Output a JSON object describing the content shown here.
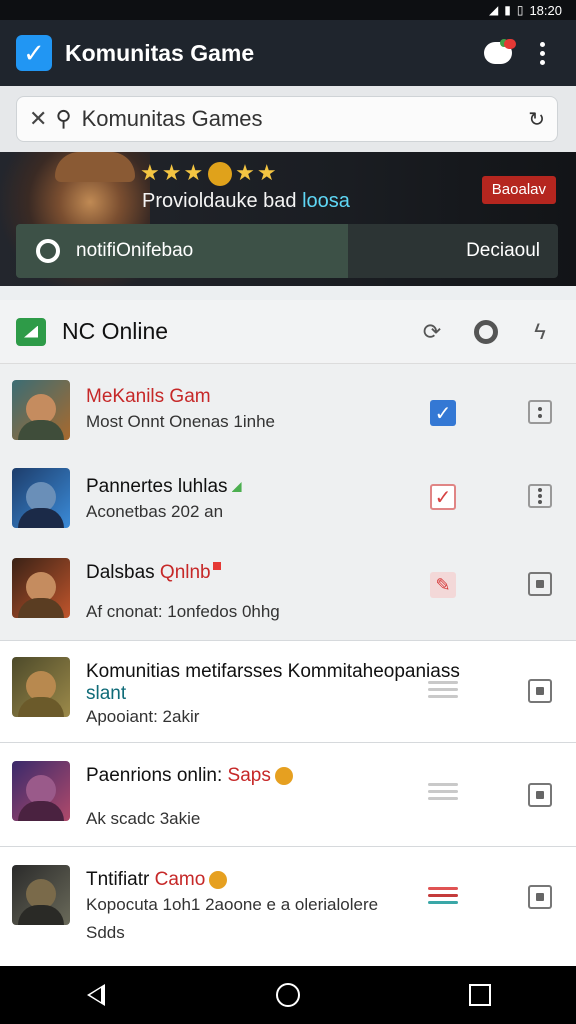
{
  "status": {
    "time": "18:20"
  },
  "appbar": {
    "title": "Komunitas Game"
  },
  "search": {
    "value": "Komunitas Games"
  },
  "banner": {
    "subtitle_a": "Provioldauke bad ",
    "subtitle_b": "loosa",
    "badge": "Baoalav",
    "bar_left": "notifiOnifebao",
    "bar_right": "Deciaoul"
  },
  "section": {
    "title": "NC Online"
  },
  "items": [
    {
      "title_red": "MeKanils Gam",
      "subtitle": "Most Onnt Onenas 1inhe"
    },
    {
      "title": "Pannertes luhlas",
      "subtitle": "Aconetbas 202 an"
    },
    {
      "title": "Dalsbas ",
      "title_red": "Qnlnb",
      "subtitle": "Af cnonat: 1onfedos 0hhg"
    },
    {
      "title": "Komunitias metifarsses Kommitaheopaniass",
      "title2": "slant",
      "subtitle": "Apooiant: 2akir"
    },
    {
      "title": "Paenrions onlin: ",
      "title_red": "Saps",
      "subtitle": "Ak scadc 3akie"
    },
    {
      "title": "Tntifiatr ",
      "title_red": "Camo",
      "subtitle": "Kopocuta 1oh1 2aoone e a olerialolere",
      "subtitle2": "Sdds"
    }
  ],
  "colors": {
    "appbar": "#1f252d",
    "accent_blue": "#3478d4",
    "accent_red": "#c62828",
    "accent_green": "#2e9b48"
  }
}
